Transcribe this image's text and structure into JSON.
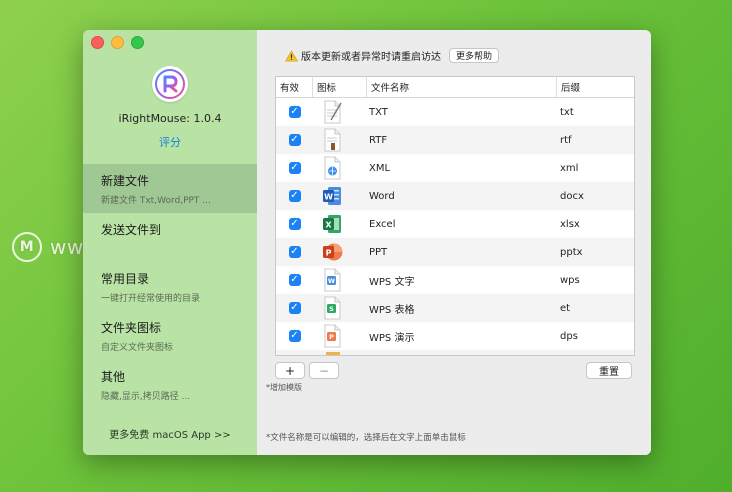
{
  "watermark": "www.MacDown.com",
  "sidebar": {
    "app_name": "iRightMouse: 1.0.4",
    "rate_label": "评分",
    "items": [
      {
        "title": "新建文件",
        "subtitle": "新建文件 Txt,Word,PPT ...",
        "active": true
      },
      {
        "title": "发送文件到",
        "subtitle": "",
        "active": false
      },
      {
        "title": "常用目录",
        "subtitle": "一键打开经常使用的目录",
        "active": false
      },
      {
        "title": "文件夹图标",
        "subtitle": "自定义文件夹图标",
        "active": false
      },
      {
        "title": "其他",
        "subtitle": "隐藏,显示,拷贝路径 ...",
        "active": false
      }
    ],
    "more_apps": "更多免费 macOS App >>"
  },
  "main": {
    "notice": "版本更新或者异常时请重启访达",
    "help_button": "更多帮助",
    "columns": [
      "有效",
      "图标",
      "文件名称",
      "后缀"
    ],
    "rows": [
      {
        "enabled": true,
        "icon": "txt-file-icon",
        "name": "TXT",
        "ext": "txt"
      },
      {
        "enabled": true,
        "icon": "rtf-file-icon",
        "name": "RTF",
        "ext": "rtf"
      },
      {
        "enabled": true,
        "icon": "xml-file-icon",
        "name": "XML",
        "ext": "xml"
      },
      {
        "enabled": true,
        "icon": "word-icon",
        "name": "Word",
        "ext": "docx"
      },
      {
        "enabled": true,
        "icon": "excel-icon",
        "name": "Excel",
        "ext": "xlsx"
      },
      {
        "enabled": true,
        "icon": "powerpoint-icon",
        "name": "PPT",
        "ext": "pptx"
      },
      {
        "enabled": true,
        "icon": "wps-writer-icon",
        "name": "WPS 文字",
        "ext": "wps"
      },
      {
        "enabled": true,
        "icon": "wps-sheet-icon",
        "name": "WPS 表格",
        "ext": "et"
      },
      {
        "enabled": true,
        "icon": "wps-slides-icon",
        "name": "WPS 演示",
        "ext": "dps"
      }
    ],
    "add_label": "+",
    "remove_label": "−",
    "reset_label": "重置",
    "add_hint": "*增加模版",
    "footer_hint": "*文件名称是可以编辑的，选择后在文字上面单击鼠标"
  },
  "colors": {
    "accent": "#1b82f6",
    "sidebar": "#b9e3a5",
    "sidebar_active": "#a0c894"
  }
}
